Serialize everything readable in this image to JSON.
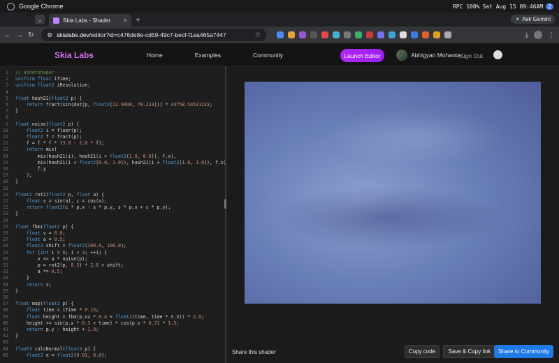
{
  "os_bar": {
    "app_name": "Google Chrome",
    "status": "RPC 100%",
    "datetime": "Sat Aug 15 09:46AM",
    "notif_count": "2"
  },
  "browser": {
    "tab_title": "Skia Labs - Shader",
    "url_host": "skialabs.dev",
    "url_path": "/editor?id=c476de8e-cd59-49c7-becf-f1aa465a7447",
    "ask_gemini": "Ask Gemini"
  },
  "header": {
    "brand": "Skia Labs",
    "nav": [
      "Home",
      "Examples",
      "Community"
    ],
    "launch": "Launch Editor",
    "user_name": "Abhigyan Mohanta",
    "sign_out": "Sign Out"
  },
  "editor": {
    "lines": [
      "// kind=shader",
      "uniform float iTime;",
      "uniform float2 iResolution;",
      "",
      "float hash21(float2 p) {",
      "    return fract(sin(dot(p, float2(12.9898, 78.233))) * 43758.5453123);",
      "}",
      "",
      "float noise(float2 p) {",
      "    float2 i = floor(p);",
      "    float2 f = fract(p);",
      "    f = f * f * (3.0 - 2.0 * f);",
      "    return mix(",
      "        mix(hash21(i), hash21(i + float2(1.0, 0.0)), f.x),",
      "        mix(hash21(i + float2(0.0, 1.0)), hash21(i + float2(1.0, 1.0)), f.x),",
      "        f.y",
      "    );",
      "}",
      "",
      "float2 rot2(float2 p, float a) {",
      "    float s = sin(a), c = cos(a);",
      "    return float2(c * p.x - s * p.y, s * p.x + c * p.y);",
      "}",
      "",
      "float fbm(float2 p) {",
      "    float v = 0.0;",
      "    float a = 0.5;",
      "    float2 shift = float2(100.0, 100.0);",
      "    for (int i = 0; i < 3; ++i) {",
      "        v += a * noise(p);",
      "        p = rot2(p, 0.5) * 2.0 + shift;",
      "        a *= 0.5;",
      "    }",
      "    return v;",
      "}",
      "",
      "float map(float3 p) {",
      "    float time = iTime * 0.15;",
      "    float height = fbm(p.xz * 0.4 + float2(time, time * 0.8)) * 2.0;",
      "    height += sin(p.x * 0.3 + time) * cos(p.z * 0.3) * 1.5;",
      "    return p.y - height + 1.0;",
      "}",
      "",
      "float3 calcNormal(float3 p) {",
      "    float2 e = float2(0.01, 0.0);"
    ]
  },
  "preview": {
    "share_label": "Share this shader",
    "copy_code": "Copy code",
    "save_copy": "Save & Copy link",
    "share_community": "Share to Community"
  }
}
